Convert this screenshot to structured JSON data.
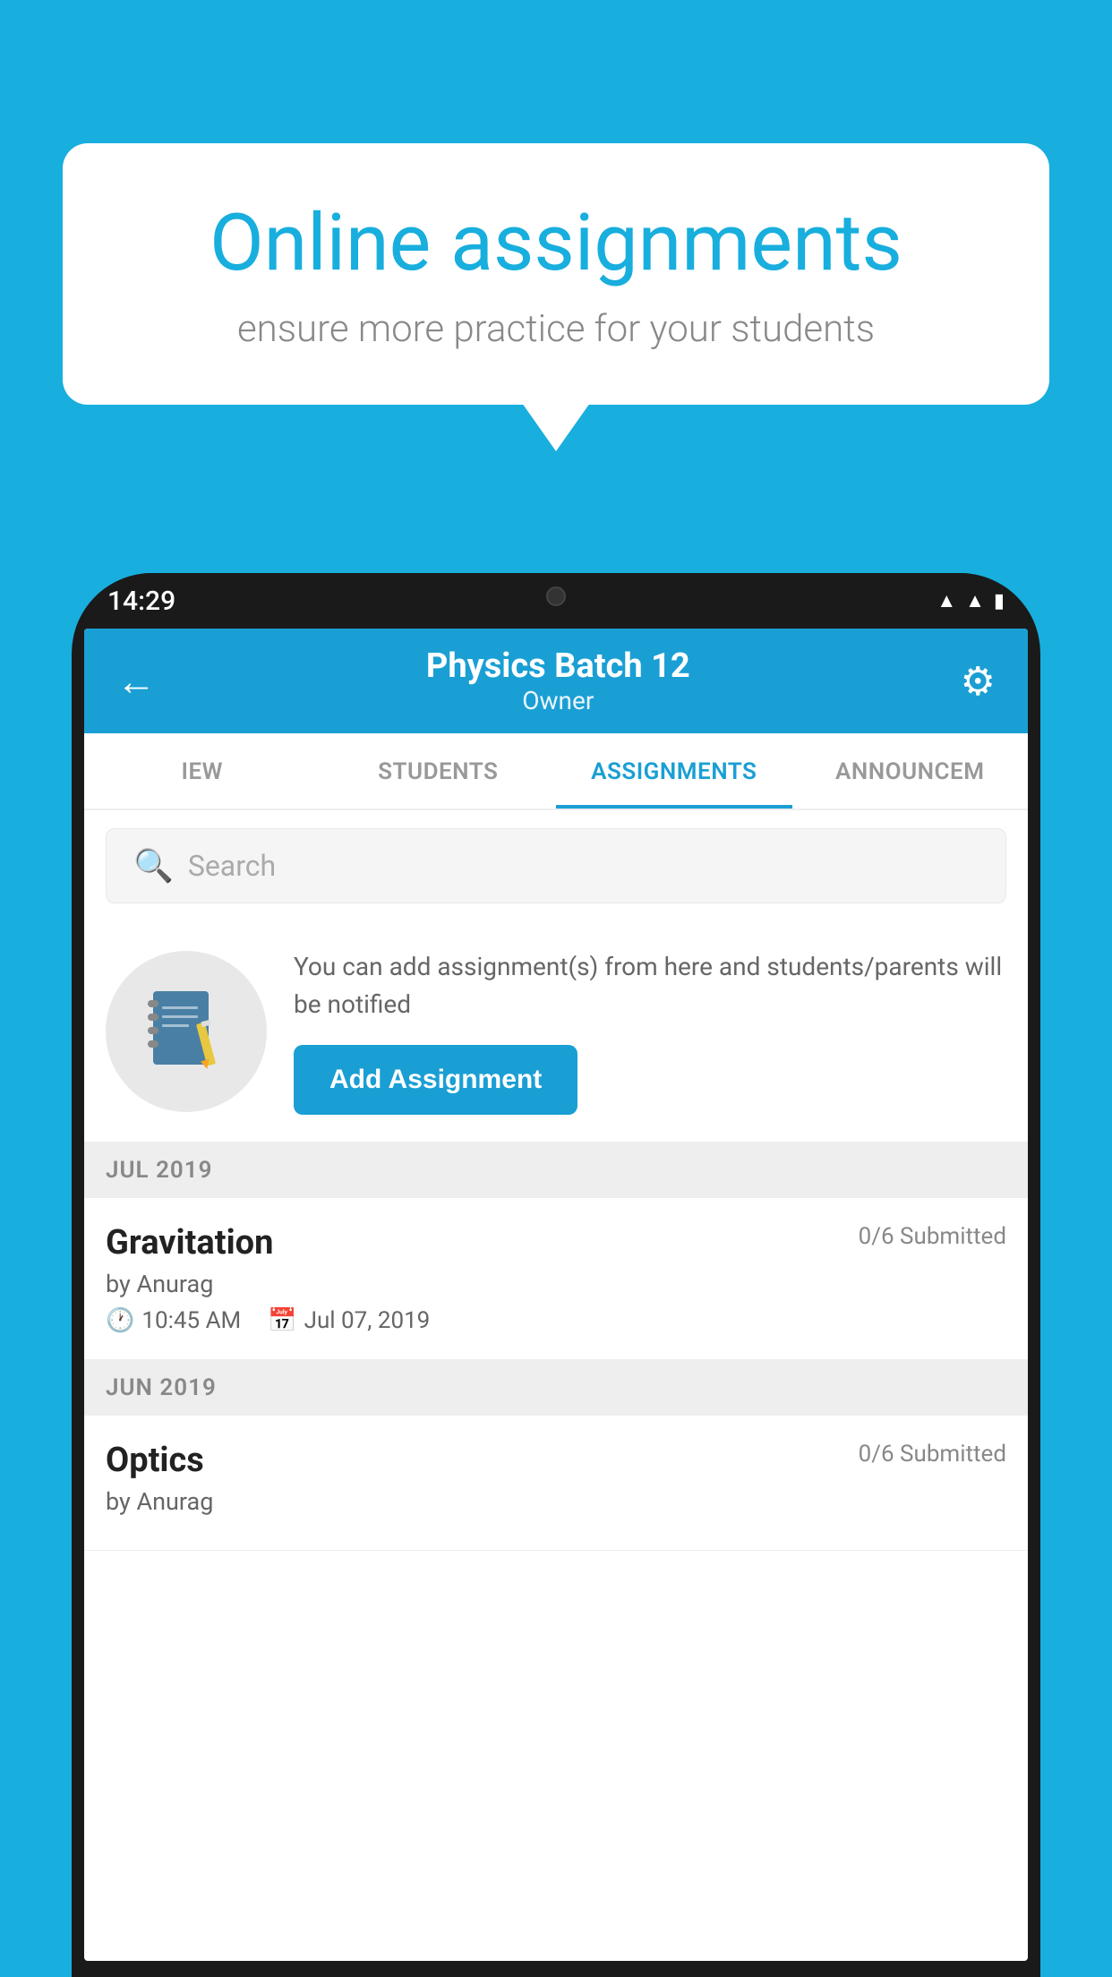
{
  "background_color": "#18AEDE",
  "speech_bubble": {
    "title": "Online assignments",
    "subtitle": "ensure more practice for your students"
  },
  "status_bar": {
    "time": "14:29",
    "icons": [
      "wifi",
      "signal",
      "battery"
    ]
  },
  "header": {
    "title": "Physics Batch 12",
    "subtitle": "Owner",
    "back_label": "←",
    "gear_label": "⚙"
  },
  "tabs": [
    {
      "label": "IEW",
      "active": false
    },
    {
      "label": "STUDENTS",
      "active": false
    },
    {
      "label": "ASSIGNMENTS",
      "active": true
    },
    {
      "label": "ANNOUNCEM",
      "active": false
    }
  ],
  "search": {
    "placeholder": "Search"
  },
  "promo": {
    "text": "You can add assignment(s) from here and students/parents will be notified",
    "button_label": "Add Assignment"
  },
  "sections": [
    {
      "label": "JUL 2019",
      "assignments": [
        {
          "name": "Gravitation",
          "submitted": "0/6 Submitted",
          "by": "by Anurag",
          "time": "10:45 AM",
          "date": "Jul 07, 2019"
        }
      ]
    },
    {
      "label": "JUN 2019",
      "assignments": [
        {
          "name": "Optics",
          "submitted": "0/6 Submitted",
          "by": "by Anurag",
          "time": "",
          "date": ""
        }
      ]
    }
  ]
}
